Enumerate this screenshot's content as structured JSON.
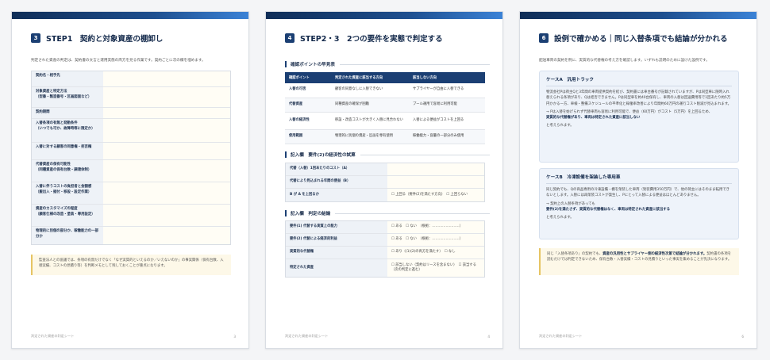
{
  "pages": [
    {
      "num": "3",
      "title": "STEP1　契約と対象資産の棚卸し",
      "intro": "判定された資産の判定は、契約書の文言と運用実態の両方を見る作業です。契約ごとに次の欄を埋めます。",
      "form_rows": [
        "契約名・相手先",
        "対象資産と特定方法\n（型番・製造番号・区画図面など）",
        "契約期間",
        "入替条項の有無と発動条件\n（いつでも可か、故障時等に限定か）",
        "入替に対する顧客の同意権・拒否権",
        "代替資産の保有可能性\n（同種資産の保有台数・調達体制）",
        "入替に伴うコストの負担者と金額感\n（搬出入・据付・移設・設定作業）",
        "資産のカスタマイズの程度\n（顧客仕様の改造・塗装・専用設定）",
        "物理的に別個の部分か、稼働能力の一部分か"
      ],
      "note": "監査法人との協議では、条項の有無だけでなく「なぜ実質的といえるのか／いえないのか」の事実関係（保有台数、入替実績、コストの見積り等）を判断メモとして残しておくことが重点になります。",
      "footer_left": "判定された資産の判定シート",
      "footer_right": "3"
    },
    {
      "num": "4",
      "title": "STEP2・3　2つの要件を実態で判定する",
      "sub1": "確認ポイントの早見表",
      "table_headers": [
        "確認ポイント",
        "判定された資産に該当する方向",
        "該当しない方向"
      ],
      "table_rows": [
        [
          "入替の可否",
          "顧客の同意なしに入替できない",
          "サプライヤーが自由に入替できる"
        ],
        [
          "代替資産",
          "同種資産の確保が困難",
          "プール運用で容易に利用可能"
        ],
        [
          "入替の経済性",
          "移設・改造コストが大きく入替に見合わない",
          "入替による便益がコストを上回る"
        ],
        [
          "使用範囲",
          "物理的に別個の資産・区画を専有使用",
          "稼働能力・容量の一部分のみ使用"
        ]
      ],
      "sub2": "記入欄　要件(2)の経済性の試算",
      "econ_rows": [
        [
          "代替（入替）1回あたりのコスト（A）",
          ""
        ],
        [
          "代替により見込まれる年間の便益（B）",
          ""
        ],
        [
          "B が A を上回るか",
          "☐ 上回る（要件(2)を満たす方向）　☐ 上回らない"
        ]
      ],
      "sub3": "記入欄　判定の結論",
      "result_rows": [
        [
          "要件(1) 代替する実質上の能力",
          "☐ ある　☐ ない　（根拠：……………………）"
        ],
        [
          "要件(2) 代替による経済的利益",
          "☐ ある　☐ ない　（根拠：……………………）"
        ],
        [
          "実質的な代替権",
          "☐ あり（(1)(2)の両方を満たす）　☐ なし"
        ],
        [
          "特定された資産",
          "☐ 該当しない（契約はリースを含まない）　☐ 該当する（次の判定に進む）"
        ]
      ],
      "footer_left": "判定された資産の判定シート",
      "footer_right": "4"
    },
    {
      "num": "6",
      "title": "設例で確かめる｜同じ入替条項でも結論が分かれる",
      "intro": "配送車両の契約を例に、実質的な代替権の考え方を確認します。いずれも説明のために設けた設例です。",
      "caseA_title": "ケースA　汎用トラック",
      "caseA_body": "物流会社Pは荷主Qと3年間の車両提供契約を結び、契約書には車台番号が記載されていますが、Pは同型車に随時入れ替えられる条項があり、Qは拒否できません。Pは同型車を約40台保有し、車両の入替は回送費用等で1回あたり約5万円かかる一方、車検・整備スケジュールの平準化と稼働率改善により年間約60万円の運行コスト削減が見込まれます。",
      "caseA_arrow": "→ Pは入替を妨げられず代替車両も容易に利用可能で、便益（60万円）がコスト（5万円）を上回るため、",
      "caseA_concl": "実質的な代替権があり、車両は特定された資産に該当しない",
      "caseA_tail": "と考えられます。",
      "caseB_title": "ケースB　冷凍設備を架装した専用車",
      "caseB_body": "同じ契約でも、Qの商品専用の冷凍設備・棚を架装した車両（架装費用350万円）で、他の荷主にはそのまま転用できないとします。入替には再架装コストが発生し、Pにとって入替による便益はほとんどありません。",
      "caseB_arrow": "→ 契約上の入替条項があっても",
      "caseB_concl": "要件(2)を満たさず、実質的な代替権はなく、車両は特定された資産に該当する",
      "caseB_tail": "と考えられます。",
      "note_pre": "同じ「入替条項あり」の契約でも、",
      "note_bold": "資産の汎用性とサプライヤー側の経済性次第で結論が分かれます。",
      "note_post": "契約書の条項を読むだけでは判定できないため、保有台数・入替実績・コストの見積りといった事実を集めることが先決になります。",
      "footer_left": "判定された資産の判定シート",
      "footer_right": "6"
    }
  ]
}
